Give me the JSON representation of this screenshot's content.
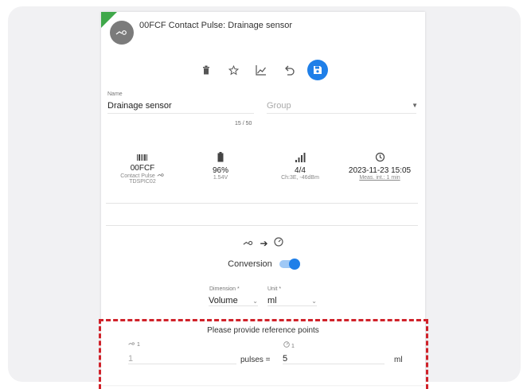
{
  "header": {
    "title": "00FCF Contact Pulse: Drainage sensor"
  },
  "toolbar": {
    "delete_icon": "trash-icon",
    "favorite_icon": "star-icon",
    "chart_icon": "chart-icon",
    "undo_icon": "undo-icon",
    "save_icon": "save-icon",
    "save_color": "#1f7fe8"
  },
  "form": {
    "name_label": "Name",
    "name_value": "Drainage sensor",
    "group_placeholder": "Group",
    "counter": "15 / 50"
  },
  "stats": {
    "id": {
      "value": "00FCF",
      "type": "Contact Pulse",
      "model": "TDSPIC02"
    },
    "battery": {
      "percent": "96%",
      "voltage": "1.54V"
    },
    "signal": {
      "value": "4/4",
      "detail": "Ch:3E, -46dBm"
    },
    "time": {
      "value": "2023-11-23 15:05",
      "interval": "Meas. int.: 1 min"
    }
  },
  "conversion": {
    "label": "Conversion",
    "enabled": true,
    "dimension_label": "Dimension *",
    "dimension_value": "Volume",
    "unit_label": "Unit *",
    "unit_value": "ml"
  },
  "reference": {
    "title": "Please provide reference points",
    "left_caption": "1",
    "right_caption": "1",
    "pulses_value": "1",
    "pulses_label": "pulses =",
    "amount_value": "5",
    "unit": "ml"
  }
}
